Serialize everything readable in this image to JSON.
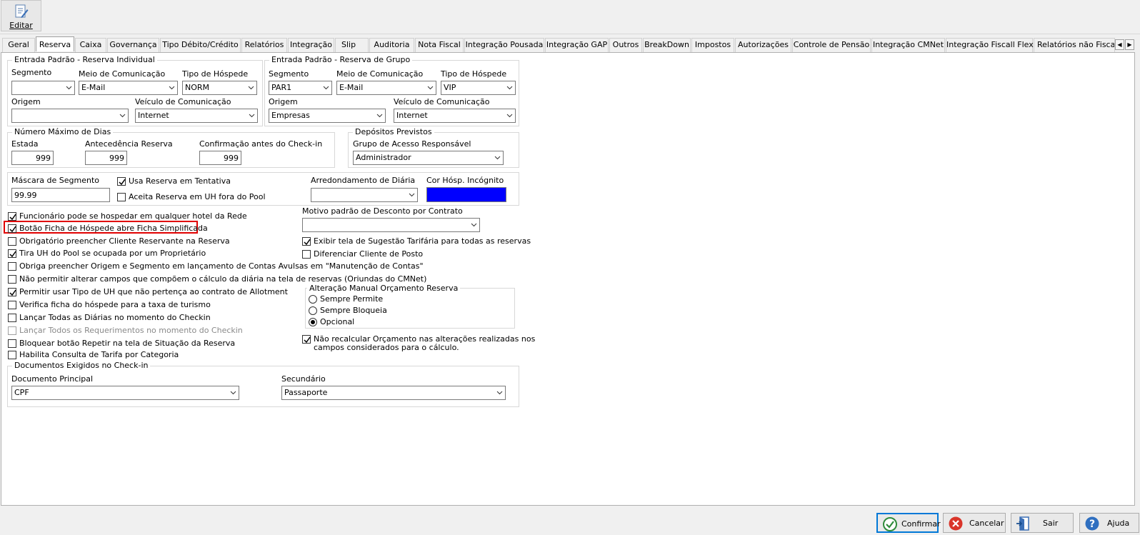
{
  "toolbar": {
    "edit_label": "Editar"
  },
  "tabs": [
    "Geral",
    "Reserva",
    "Caixa",
    "Governança",
    "Tipo Débito/Crédito",
    "Relatórios",
    "Integração",
    "Slip",
    "Auditoria",
    "Nota Fiscal",
    "Integração Pousada",
    "Integração GAP",
    "Outros",
    "BreakDown",
    "Impostos",
    "Autorizações",
    "Controle de Pensão",
    "Integração CMNet",
    "Integração Fiscall Flex",
    "Relatórios não Fisca"
  ],
  "individual": {
    "title": "Entrada Padrão - Reserva Individual",
    "segmento_label": "Segmento",
    "segmento_value": "",
    "meio_label": "Meio de Comunicação",
    "meio_value": "E-Mail",
    "tipo_label": "Tipo de Hóspede",
    "tipo_value": "NORM",
    "origem_label": "Origem",
    "origem_value": "",
    "veiculo_label": "Veículo de Comunicação",
    "veiculo_value": "Internet"
  },
  "grupo": {
    "title": "Entrada Padrão - Reserva de Grupo",
    "segmento_label": "Segmento",
    "segmento_value": "PAR1",
    "meio_label": "Meio de Comunicação",
    "meio_value": "E-Mail",
    "tipo_label": "Tipo de Hóspede",
    "tipo_value": "VIP",
    "origem_label": "Origem",
    "origem_value": "Empresas",
    "veiculo_label": "Veículo de Comunicação",
    "veiculo_value": "Internet"
  },
  "dias": {
    "title": "Número Máximo de Dias",
    "estada_label": "Estada",
    "estada_value": "999",
    "antecedencia_label": "Antecedência Reserva",
    "antecedencia_value": "999",
    "confirmacao_label": "Confirmação antes do Check-in",
    "confirmacao_value": "999"
  },
  "depositos": {
    "title": "Depósitos Previstos",
    "grupo_label": "Grupo de Acesso Responsável",
    "grupo_value": "Administrador"
  },
  "mascara": {
    "label": "Máscara de Segmento",
    "value": "99.99",
    "usa_tentativa": "Usa Reserva em Tentativa",
    "aceita_uh": "Aceita Reserva em UH fora do Pool",
    "arredondamento_label": "Arredondamento de Diária",
    "arredondamento_value": "",
    "cor_label": "Cor Hósp. Incógnito",
    "cor_value": "#0000ff"
  },
  "checks_left": [
    "Funcionário pode se hospedar em qualquer hotel da Rede",
    "Botão Ficha de Hóspede abre Ficha Simplificada",
    "Obrigatório preencher Cliente Reservante na Reserva",
    "Tira UH do Pool se ocupada por um Proprietário",
    "Obriga preencher Origem e Segmento em lançamento de Contas Avulsas em \"Manutenção de Contas\"",
    "Não permitir alterar campos que compõem o cálculo da diária na tela de reservas (Oriundas do CMNet)",
    "Permitir usar Tipo de UH que não pertença ao contrato de Allotment",
    "Verifica ficha do hóspede para a taxa de turismo",
    "Lançar Todas as Diárias no momento do Checkin",
    "Lançar Todos os Requerimentos no momento do Checkin",
    "Bloquear botão Repetir na tela de Situação da Reserva",
    "Habilita Consulta de Tarifa por Categoria"
  ],
  "motivo": {
    "label": "Motivo padrão de Desconto por Contrato",
    "value": ""
  },
  "checks_right": [
    "Exibir tela de Sugestão Tarifária para todas as reservas",
    "Diferenciar Cliente de Posto"
  ],
  "orcamento": {
    "title": "Alteração Manual Orçamento Reserva",
    "options": [
      "Sempre Permite",
      "Sempre Bloqueia",
      "Opcional"
    ],
    "selected": "Opcional"
  },
  "nao_recalcular": [
    "Não recalcular Orçamento nas alterações realizadas nos",
    "campos considerados para o cálculo."
  ],
  "documentos": {
    "title": "Documentos Exigidos no Check-in",
    "principal_label": "Documento Principal",
    "principal_value": "CPF",
    "secundario_label": "Secundário",
    "secundario_value": "Passaporte"
  },
  "buttons": {
    "confirmar": "Confirmar",
    "cancelar": "Cancelar",
    "sair": "Sair",
    "ajuda": "Ajuda"
  }
}
